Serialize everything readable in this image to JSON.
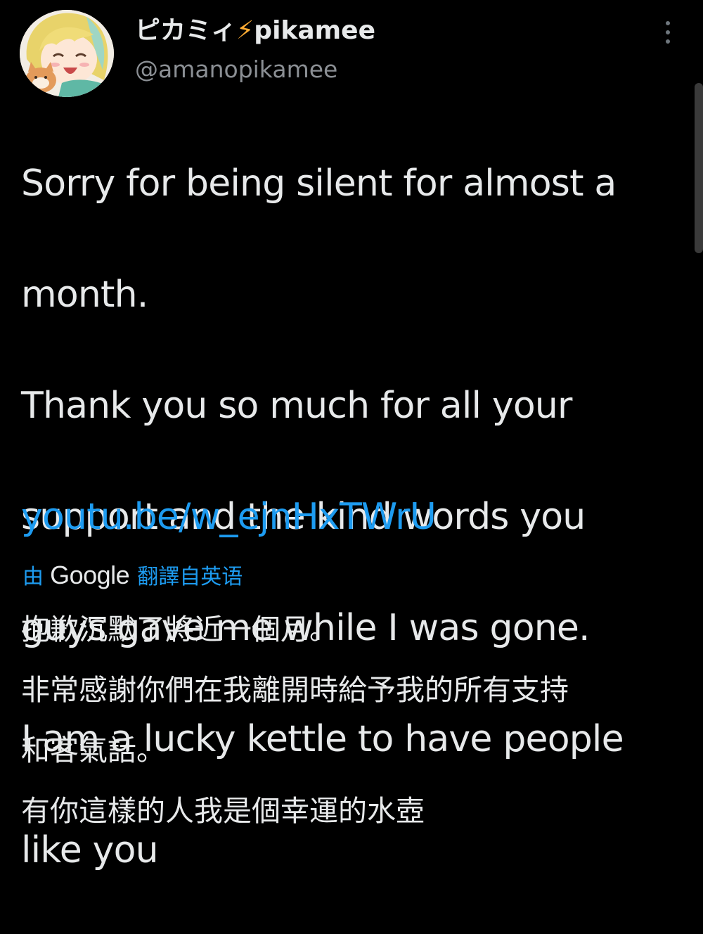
{
  "tweet": {
    "author": {
      "display_name": "ピカミィ",
      "bolt_emoji": "⚡",
      "display_name_suffix": "pikamee",
      "handle": "@amanopikamee",
      "avatar_icon": "anime-character-avatar"
    },
    "more_icon": "more-vertical-icon",
    "text_lines": [
      "Sorry for being silent for almost a",
      "month.",
      "Thank you so much for all your",
      "support and the kind words you",
      "guys gave me while I was gone.",
      "I am a lucky kettle to have people",
      "like you"
    ],
    "link": "youtu.be/w_ejnHxTWrU",
    "translation": {
      "by_label": "由",
      "provider": "Google",
      "translated_from_label": "翻譯自英语",
      "lines": [
        "抱歉沉默了將近一個月。",
        "非常感謝你們在我離開時給予我的所有支持",
        "和客氣話。",
        "有你這樣的人我是個幸運的水壺"
      ]
    },
    "colors": {
      "background": "#000000",
      "text": "#e7e9ea",
      "secondary_text": "#8b8f94",
      "link": "#1d9bf0",
      "bolt": "#ffac33"
    }
  }
}
